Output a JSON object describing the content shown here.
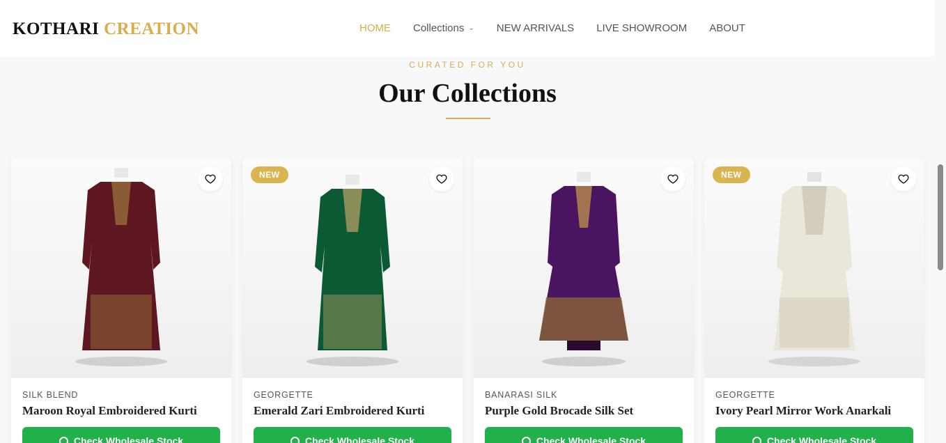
{
  "brand": {
    "part1": "KOTHARI",
    "part2": "CREATION"
  },
  "nav": {
    "home": "HOME",
    "collections": "Collections",
    "new_arrivals": "NEW ARRIVALS",
    "live_showroom": "LIVE SHOWROOM",
    "about": "ABOUT"
  },
  "section": {
    "eyebrow": "CURATED FOR YOU",
    "title": "Our Collections"
  },
  "products": [
    {
      "fabric": "SILK BLEND",
      "name": "Maroon Royal Embroidered Kurti",
      "badge": "",
      "cta": "Check Wholesale Stock",
      "color": "#5e1620"
    },
    {
      "fabric": "GEORGETTE",
      "name": "Emerald Zari Embroidered Kurti",
      "badge": "NEW",
      "cta": "Check Wholesale Stock",
      "color": "#0c5a34"
    },
    {
      "fabric": "BANARASI SILK",
      "name": "Purple Gold Brocade Silk Set",
      "badge": "",
      "cta": "Check Wholesale Stock",
      "color": "#4b1460"
    },
    {
      "fabric": "GEORGETTE",
      "name": "Ivory Pearl Mirror Work Anarkali",
      "badge": "NEW",
      "cta": "Check Wholesale Stock",
      "color": "#ebe6da"
    }
  ],
  "colors": {
    "accent": "#d9ad4a",
    "cta": "#22b04b"
  },
  "icons": {
    "favorite": "heart-icon",
    "whatsapp": "whatsapp-icon",
    "dropdown": "chevron-down-icon"
  }
}
